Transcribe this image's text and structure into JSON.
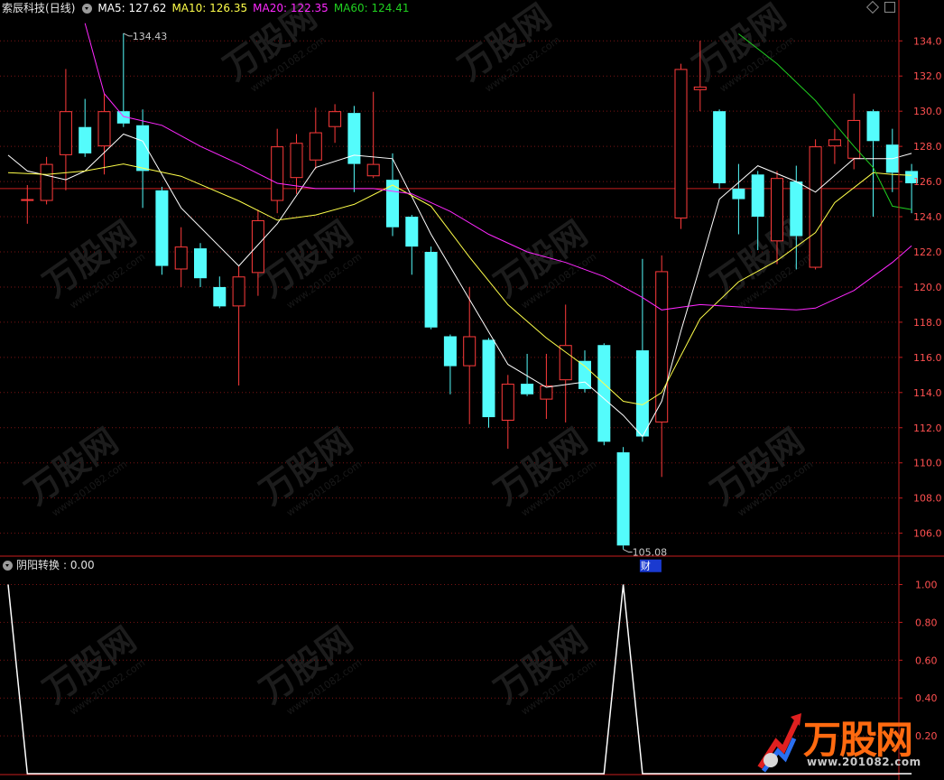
{
  "header": {
    "stock_name": "索辰科技",
    "period": "(日线)",
    "ma5_label": "MA5: 127.62",
    "ma10_label": "MA10: 126.35",
    "ma20_label": "MA20: 122.35",
    "ma60_label": "MA60: 124.41"
  },
  "indicator": {
    "label": "阴阳转换",
    "value_text": ": 0.00"
  },
  "colors": {
    "up": "#ff3b3b",
    "down": "#54fcfc",
    "ma5": "#ffffff",
    "ma10": "#ffff4a",
    "ma20": "#ff28ff",
    "ma60": "#20d020",
    "axis": "#c81e1e",
    "grid": "#7a1414",
    "tick_text": "#ff5050"
  },
  "watermark": {
    "brand": "万股网",
    "url": "www.201082.com"
  },
  "chart_data": [
    {
      "type": "candlestick",
      "ylim": [
        104.8,
        135.4
      ],
      "y_ticks": [
        106,
        108,
        110,
        112,
        114,
        116,
        118,
        120,
        122,
        124,
        126,
        128,
        130,
        132,
        134
      ],
      "y_tick_labels": [
        "106.0",
        "108.0",
        "110.0",
        "112.0",
        "114.0",
        "116.0",
        "118.0",
        "120.0",
        "122.0",
        "124.0",
        "126.0",
        "128.0",
        "130.0",
        "132.0",
        "134.0"
      ],
      "grid": true,
      "reference_line": 125.6,
      "candles": [
        {
          "o": 125.0,
          "h": 125.8,
          "l": 123.6,
          "c": 125.0
        },
        {
          "o": 124.9,
          "h": 127.4,
          "l": 124.7,
          "c": 127.0
        },
        {
          "o": 127.5,
          "h": 132.4,
          "l": 125.5,
          "c": 130.0
        },
        {
          "o": 129.1,
          "h": 130.7,
          "l": 127.4,
          "c": 127.6
        },
        {
          "o": 128.0,
          "h": 131.0,
          "l": 126.4,
          "c": 130.0
        },
        {
          "o": 130.0,
          "h": 134.43,
          "l": 129.1,
          "c": 129.3
        },
        {
          "o": 129.2,
          "h": 130.1,
          "l": 124.5,
          "c": 126.6
        },
        {
          "o": 125.5,
          "h": 125.7,
          "l": 120.7,
          "c": 121.2
        },
        {
          "o": 121.0,
          "h": 123.4,
          "l": 120.0,
          "c": 122.3
        },
        {
          "o": 122.2,
          "h": 122.5,
          "l": 120.0,
          "c": 120.5
        },
        {
          "o": 120.0,
          "h": 120.6,
          "l": 118.8,
          "c": 118.9
        },
        {
          "o": 118.9,
          "h": 121.2,
          "l": 114.4,
          "c": 120.6
        },
        {
          "o": 120.8,
          "h": 124.4,
          "l": 119.5,
          "c": 123.8
        },
        {
          "o": 124.9,
          "h": 129.0,
          "l": 124.2,
          "c": 128.0
        },
        {
          "o": 126.2,
          "h": 128.7,
          "l": 125.3,
          "c": 128.2
        },
        {
          "o": 127.2,
          "h": 130.2,
          "l": 126.7,
          "c": 128.8
        },
        {
          "o": 129.1,
          "h": 130.4,
          "l": 128.2,
          "c": 130.0
        },
        {
          "o": 129.9,
          "h": 130.3,
          "l": 125.4,
          "c": 127.0
        },
        {
          "o": 126.3,
          "h": 131.1,
          "l": 126.2,
          "c": 127.0
        },
        {
          "o": 126.1,
          "h": 127.6,
          "l": 122.9,
          "c": 123.4
        },
        {
          "o": 124.0,
          "h": 124.1,
          "l": 120.7,
          "c": 122.3
        },
        {
          "o": 122.0,
          "h": 122.3,
          "l": 117.6,
          "c": 117.7
        },
        {
          "o": 117.2,
          "h": 117.3,
          "l": 113.9,
          "c": 115.5
        },
        {
          "o": 115.5,
          "h": 120.0,
          "l": 112.2,
          "c": 117.2
        },
        {
          "o": 117.0,
          "h": 117.1,
          "l": 112.0,
          "c": 112.6
        },
        {
          "o": 112.4,
          "h": 115.0,
          "l": 110.8,
          "c": 114.5
        },
        {
          "o": 114.5,
          "h": 116.2,
          "l": 113.8,
          "c": 113.9
        },
        {
          "o": 113.6,
          "h": 116.2,
          "l": 112.5,
          "c": 114.4
        },
        {
          "o": 114.7,
          "h": 119.0,
          "l": 112.3,
          "c": 116.7
        },
        {
          "o": 115.8,
          "h": 116.4,
          "l": 114.0,
          "c": 114.2
        },
        {
          "o": 116.7,
          "h": 116.8,
          "l": 111.0,
          "c": 111.2
        },
        {
          "o": 110.6,
          "h": 110.9,
          "l": 105.08,
          "c": 105.3
        },
        {
          "o": 116.4,
          "h": 121.6,
          "l": 111.2,
          "c": 111.5
        },
        {
          "o": 112.3,
          "h": 121.8,
          "l": 109.2,
          "c": 120.9
        },
        {
          "o": 123.9,
          "h": 132.7,
          "l": 123.3,
          "c": 132.4
        },
        {
          "o": 131.2,
          "h": 134.0,
          "l": 130.0,
          "c": 131.4
        },
        {
          "o": 130.0,
          "h": 130.1,
          "l": 125.6,
          "c": 125.9
        },
        {
          "o": 125.6,
          "h": 127.0,
          "l": 123.0,
          "c": 125.0
        },
        {
          "o": 126.4,
          "h": 126.6,
          "l": 122.1,
          "c": 124.0
        },
        {
          "o": 122.6,
          "h": 126.6,
          "l": 121.3,
          "c": 126.2
        },
        {
          "o": 126.0,
          "h": 126.9,
          "l": 121.0,
          "c": 122.9
        },
        {
          "o": 121.1,
          "h": 128.4,
          "l": 121.0,
          "c": 128.0
        },
        {
          "o": 128.0,
          "h": 129.0,
          "l": 127.0,
          "c": 128.4
        },
        {
          "o": 127.3,
          "h": 131.0,
          "l": 126.7,
          "c": 129.5
        },
        {
          "o": 130.0,
          "h": 130.1,
          "l": 124.0,
          "c": 128.3
        },
        {
          "o": 128.1,
          "h": 129.0,
          "l": 125.4,
          "c": 126.5
        },
        {
          "o": 126.6,
          "h": 127.0,
          "l": 124.2,
          "c": 125.9
        }
      ],
      "ma_series": [
        {
          "name": "MA5",
          "color": "#ffffff",
          "points": [
            [
              -1,
              127.5
            ],
            [
              0,
              126.6
            ],
            [
              2,
              126.1
            ],
            [
              3,
              126.6
            ],
            [
              5,
              128.7
            ],
            [
              6,
              128.3
            ],
            [
              8,
              124.5
            ],
            [
              10,
              122.3
            ],
            [
              11,
              121.2
            ],
            [
              13,
              123.6
            ],
            [
              15,
              126.8
            ],
            [
              17,
              127.5
            ],
            [
              19,
              127.3
            ],
            [
              21,
              123.0
            ],
            [
              23,
              119.3
            ],
            [
              25,
              115.6
            ],
            [
              27,
              114.3
            ],
            [
              29,
              114.6
            ],
            [
              31,
              112.7
            ],
            [
              32,
              111.5
            ],
            [
              33,
              113.5
            ],
            [
              34,
              117.5
            ],
            [
              35,
              121.2
            ],
            [
              36,
              125.0
            ],
            [
              38,
              126.9
            ],
            [
              40,
              126.0
            ],
            [
              41,
              125.4
            ],
            [
              43,
              127.3
            ],
            [
              45,
              127.3
            ],
            [
              46,
              127.6
            ]
          ]
        },
        {
          "name": "MA10",
          "color": "#ffff4a",
          "points": [
            [
              -1,
              126.5
            ],
            [
              1,
              126.4
            ],
            [
              3,
              126.6
            ],
            [
              5,
              127.0
            ],
            [
              8,
              126.3
            ],
            [
              11,
              124.9
            ],
            [
              13,
              123.8
            ],
            [
              15,
              124.1
            ],
            [
              17,
              124.7
            ],
            [
              19,
              125.8
            ],
            [
              21,
              124.6
            ],
            [
              23,
              121.7
            ],
            [
              25,
              119.0
            ],
            [
              27,
              117.1
            ],
            [
              29,
              115.5
            ],
            [
              31,
              113.5
            ],
            [
              32,
              113.3
            ],
            [
              33,
              114.0
            ],
            [
              35,
              118.2
            ],
            [
              37,
              120.3
            ],
            [
              39,
              121.5
            ],
            [
              41,
              123.1
            ],
            [
              42,
              124.8
            ],
            [
              44,
              126.5
            ],
            [
              45,
              126.4
            ],
            [
              46,
              126.35
            ]
          ]
        },
        {
          "name": "MA20",
          "color": "#ff28ff",
          "points": [
            [
              3,
              135.0
            ],
            [
              4,
              131.0
            ],
            [
              5,
              129.7
            ],
            [
              7,
              129.2
            ],
            [
              9,
              128.0
            ],
            [
              11,
              127.0
            ],
            [
              13,
              125.9
            ],
            [
              15,
              125.6
            ],
            [
              18,
              125.6
            ],
            [
              20,
              125.3
            ],
            [
              22,
              124.3
            ],
            [
              24,
              123.0
            ],
            [
              26,
              122.0
            ],
            [
              28,
              121.4
            ],
            [
              30,
              120.6
            ],
            [
              32,
              119.4
            ],
            [
              33,
              118.7
            ],
            [
              35,
              119.0
            ],
            [
              38,
              118.8
            ],
            [
              40,
              118.7
            ],
            [
              41,
              118.8
            ],
            [
              43,
              119.8
            ],
            [
              45,
              121.4
            ],
            [
              46,
              122.35
            ]
          ]
        },
        {
          "name": "MA60",
          "color": "#20d020",
          "points": [
            [
              37,
              134.4
            ],
            [
              39,
              132.7
            ],
            [
              41,
              130.6
            ],
            [
              43,
              128.0
            ],
            [
              44,
              126.8
            ],
            [
              45,
              124.6
            ],
            [
              46,
              124.41
            ]
          ]
        }
      ],
      "annotations": [
        {
          "text": "134.43",
          "at_candle": 5,
          "price": 134.43
        },
        {
          "text": "105.08",
          "at_candle": 31,
          "price": 105.08
        },
        {
          "text": "财",
          "at_candle": 32,
          "price": 104.3
        }
      ]
    },
    {
      "type": "line",
      "name": "阴阳转换",
      "ylim": [
        0,
        1.05
      ],
      "y_ticks": [
        0.2,
        0.4,
        0.6,
        0.8,
        1.0
      ],
      "y_tick_labels": [
        "0.20",
        "0.40",
        "0.60",
        "0.80",
        "1.00"
      ],
      "grid": true,
      "x": [
        -1,
        0,
        1,
        2,
        28,
        29,
        30,
        31,
        32,
        45,
        46
      ],
      "values": [
        1.0,
        0.0,
        0.0,
        0.0,
        0.0,
        0.0,
        0.0,
        1.0,
        0.0,
        0.0,
        0.0
      ]
    }
  ]
}
